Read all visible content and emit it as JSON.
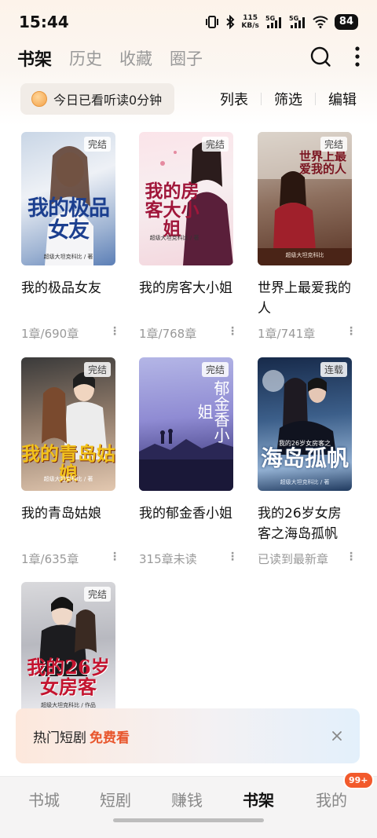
{
  "status_bar": {
    "time": "15:44",
    "net_speed_value": "115",
    "net_speed_unit": "KB/s",
    "battery": "84"
  },
  "header": {
    "tabs": [
      {
        "label": "书架",
        "active": true
      },
      {
        "label": "历史",
        "active": false
      },
      {
        "label": "收藏",
        "active": false
      },
      {
        "label": "圈子",
        "active": false
      }
    ],
    "icons": [
      "search-icon",
      "more-vertical-icon"
    ]
  },
  "toolbar": {
    "reading_stat": "今日已看听读0分钟",
    "actions": [
      "列表",
      "筛选",
      "编辑"
    ]
  },
  "books": [
    {
      "title": "我的极品女友",
      "meta": "1章/690章",
      "badge": "完结",
      "cover_title": "我的极品女友",
      "cover_author": "超级大坦克科比 / 著"
    },
    {
      "title": "我的房客大小姐",
      "meta": "1章/768章",
      "badge": "完结",
      "cover_title": "我的房客大小姐",
      "cover_author": "超级大坦克科比 / 著"
    },
    {
      "title": "世界上最爱我的人",
      "meta": "1章/741章",
      "badge": "完结",
      "cover_title": "世界上最爱我的人",
      "cover_author": "超级大坦克科比"
    },
    {
      "title": "我的青岛姑娘",
      "meta": "1章/635章",
      "badge": "完结",
      "cover_title": "我的青岛姑娘",
      "cover_author": "超级大坦克科比 / 著"
    },
    {
      "title": "我的郁金香小姐",
      "meta": "315章未读",
      "badge": "完结",
      "cover_title": "郁金香小姐",
      "cover_author": ""
    },
    {
      "title": "我的26岁女房客之海岛孤帆",
      "meta": "已读到最新章",
      "badge": "连载",
      "cover_title": "海岛孤帆",
      "cover_subtitle": "我的26岁女房客之",
      "cover_author": "超级大坦克科比 / 著"
    },
    {
      "title": "我的26岁女房客",
      "meta": "",
      "badge": "完结",
      "cover_title": "我的26岁女房客",
      "cover_author": "超级大坦克科比 / 作品"
    }
  ],
  "banner": {
    "text": "热门短剧",
    "highlight": "免费看",
    "close_icon": "close-icon"
  },
  "bottom_nav": {
    "items": [
      {
        "label": "书城",
        "active": false
      },
      {
        "label": "短剧",
        "active": false
      },
      {
        "label": "赚钱",
        "active": false
      },
      {
        "label": "书架",
        "active": true
      },
      {
        "label": "我的",
        "active": false
      }
    ],
    "badge": "99+"
  },
  "colors": {
    "accent": "#e8562d",
    "badge": "#f25a2c"
  }
}
